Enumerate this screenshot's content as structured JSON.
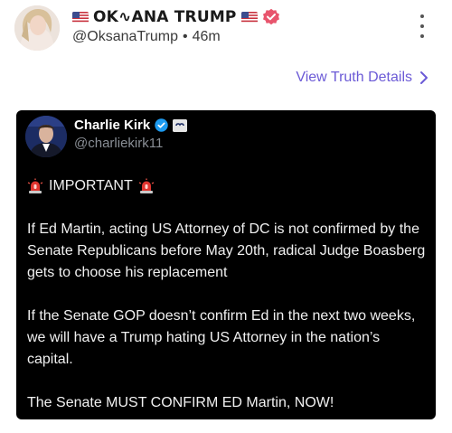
{
  "post": {
    "display_name": "OK∿ANA TRUMP",
    "handle": "@OksanaTrump",
    "separator": "•",
    "time": "46m",
    "view_details_label": "View Truth Details",
    "flag_icon": "us-flag",
    "badge_icon": "verified-badge",
    "accent_color": "#6b5ad6",
    "badge_color": "#e8556d"
  },
  "embed": {
    "name": "Charlie Kirk",
    "handle": "@charliekirk11",
    "important_label": "IMPORTANT",
    "siren_icon": "police-siren",
    "paragraphs": [
      "If Ed Martin, acting US Attorney of DC is not confirmed by the Senate Republicans before May 20th, radical Judge Boasberg gets to choose his replacement",
      "If the Senate GOP doesn’t confirm Ed in the next two weeks, we will have a Trump hating US Attorney in the nation’s capital.",
      "The Senate MUST CONFIRM ED Martin, NOW!"
    ],
    "background_color": "#000000"
  }
}
